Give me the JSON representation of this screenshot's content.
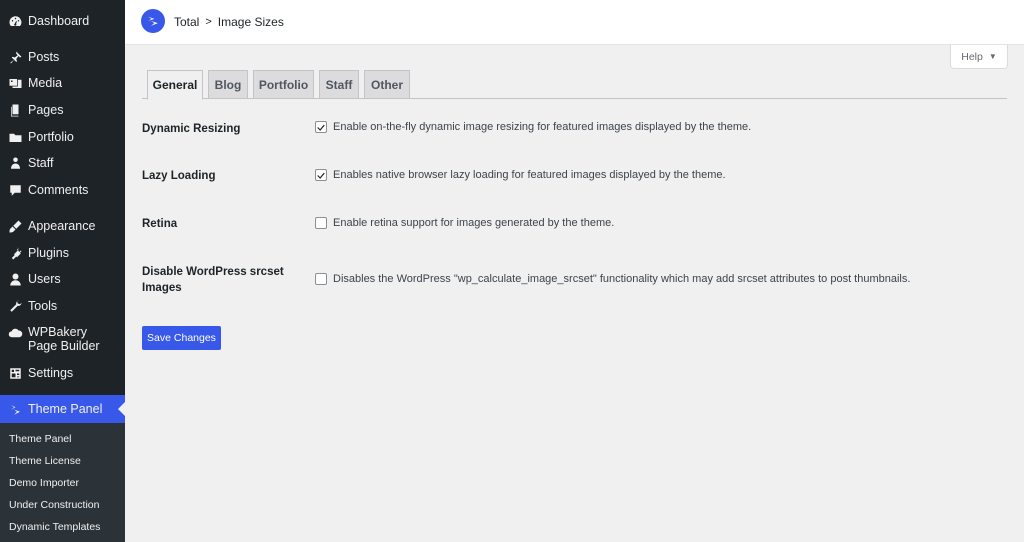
{
  "sidebar": {
    "items": [
      {
        "label": "Dashboard",
        "icon": "dashboard-icon"
      },
      {
        "label": "Posts",
        "icon": "pin-icon"
      },
      {
        "label": "Media",
        "icon": "media-icon"
      },
      {
        "label": "Pages",
        "icon": "pages-icon"
      },
      {
        "label": "Portfolio",
        "icon": "folder-icon"
      },
      {
        "label": "Staff",
        "icon": "person-icon"
      },
      {
        "label": "Comments",
        "icon": "comment-icon"
      },
      {
        "label": "Appearance",
        "icon": "brush-icon"
      },
      {
        "label": "Plugins",
        "icon": "plug-icon"
      },
      {
        "label": "Users",
        "icon": "user-icon"
      },
      {
        "label": "Tools",
        "icon": "wrench-icon"
      },
      {
        "label": "WPBakery Page Builder",
        "icon": "cloud-icon"
      },
      {
        "label": "Settings",
        "icon": "settings-icon"
      },
      {
        "label": "Theme Panel",
        "icon": "theme-panel-icon",
        "current": true
      }
    ],
    "submenu": [
      "Theme Panel",
      "Theme License",
      "Demo Importer",
      "Under Construction",
      "Dynamic Templates"
    ]
  },
  "topbar": {
    "logo_icon": "total-logo-icon",
    "app_name": "Total",
    "separator": ">",
    "page_title": "Image Sizes"
  },
  "help": {
    "label": "Help",
    "caret": "▼"
  },
  "tabs": [
    "General",
    "Blog",
    "Portfolio",
    "Staff",
    "Other"
  ],
  "active_tab": "General",
  "settings": [
    {
      "label": "Dynamic Resizing",
      "checked": true,
      "description": "Enable on-the-fly dynamic image resizing for featured images displayed by the theme."
    },
    {
      "label": "Lazy Loading",
      "checked": true,
      "description": "Enables native browser lazy loading for featured images displayed by the theme."
    },
    {
      "label": "Retina",
      "checked": false,
      "description": "Enable retina support for images generated by the theme."
    },
    {
      "label": "Disable WordPress srcset Images",
      "checked": false,
      "description": "Disables the WordPress \"wp_calculate_image_srcset\" functionality which may add srcset attributes to post thumbnails."
    }
  ],
  "save_button": "Save Changes",
  "colors": {
    "accent": "#3858e9",
    "sidebar_bg": "#1d2327",
    "content_bg": "#f0f0f1"
  }
}
